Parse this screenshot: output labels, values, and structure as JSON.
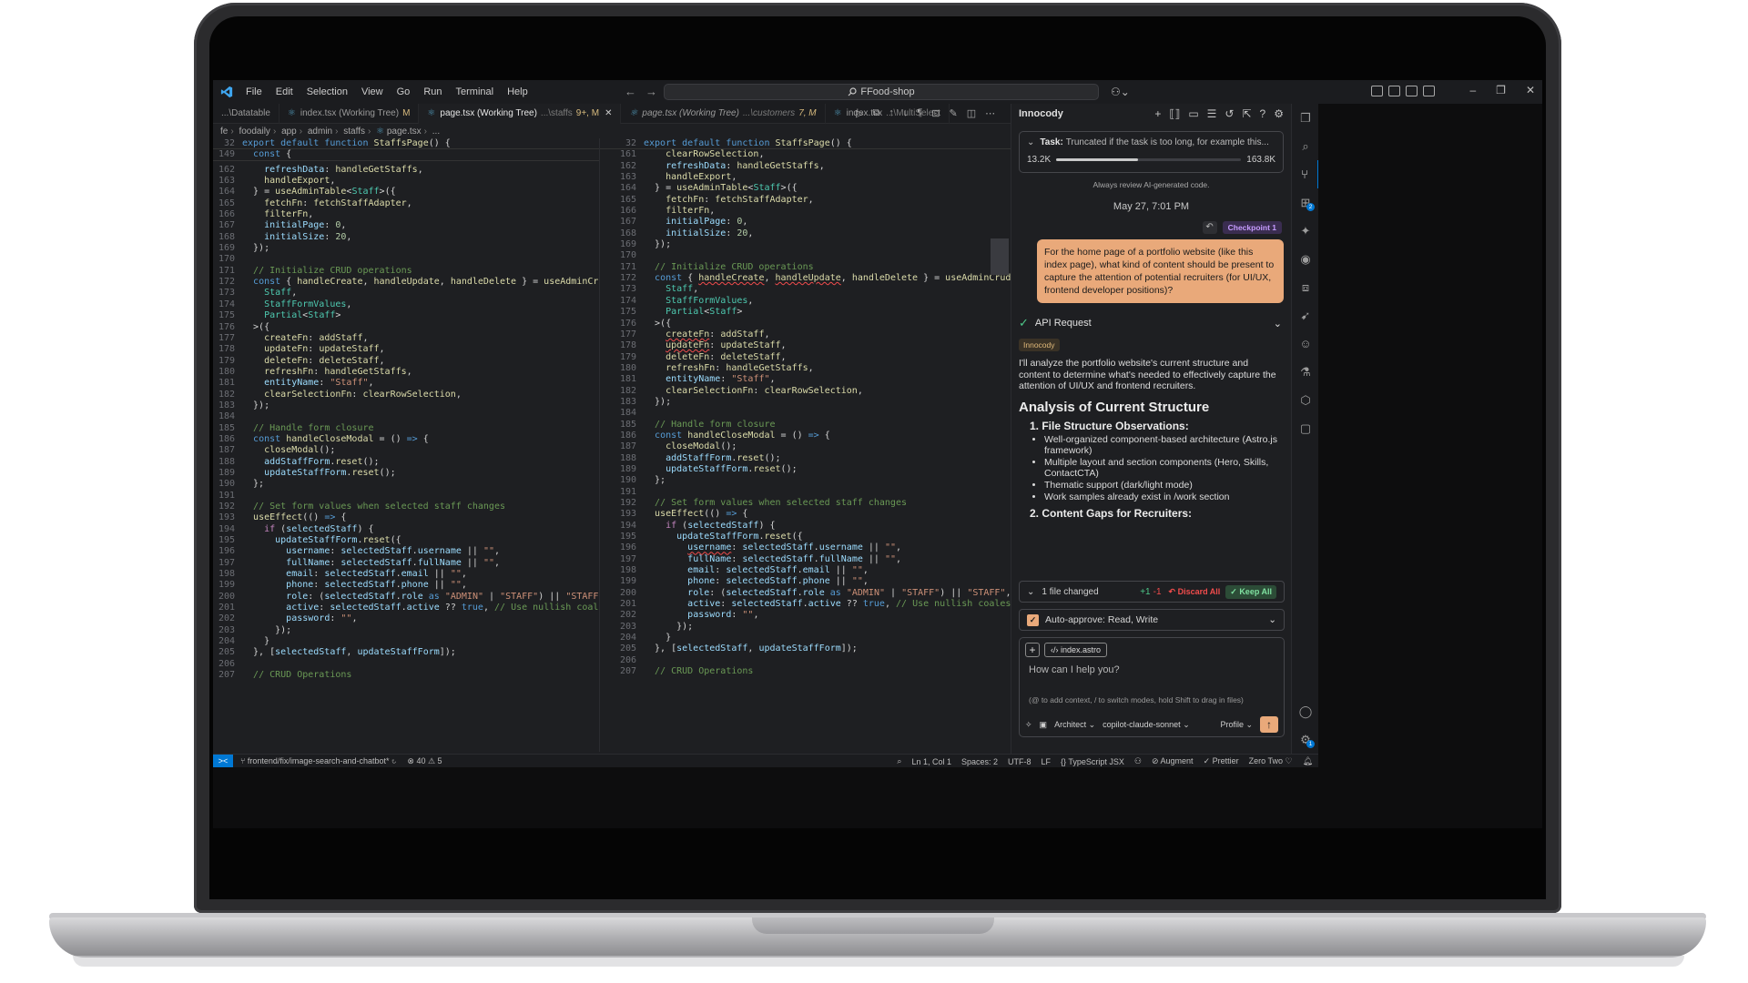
{
  "menu": [
    "File",
    "Edit",
    "Selection",
    "View",
    "Go",
    "Run",
    "Terminal",
    "Help"
  ],
  "search": {
    "label": "FFood-shop"
  },
  "tabs": [
    {
      "name": "index.tsx",
      "detail": "...\\Datatable",
      "mod": "",
      "state": "dim"
    },
    {
      "name": "index.tsx (Working Tree)",
      "detail": "",
      "mod": "M",
      "state": "normal"
    },
    {
      "name": "page.tsx (Working Tree)",
      "detail": "...\\staffs",
      "mod": "9+, M",
      "state": "active"
    },
    {
      "name": "page.tsx (Working Tree)",
      "detail": "...\\customers",
      "mod": "7, M",
      "state": "italic"
    },
    {
      "name": "index.tsx",
      "detail": "...\\MultiSelect",
      "mod": "",
      "state": "dim"
    }
  ],
  "breadcrumb": [
    "fe",
    "foodaily",
    "app",
    "admin",
    "staffs",
    "page.tsx",
    "..."
  ],
  "left_lines": [
    32,
    149,
    162,
    163,
    164,
    165,
    166,
    167,
    168,
    169,
    170,
    171,
    172,
    173,
    174,
    175,
    176,
    177,
    178,
    179,
    180,
    181,
    182,
    183,
    184,
    185,
    186,
    187,
    188,
    189,
    190,
    191,
    192,
    193,
    194,
    195,
    196,
    197,
    198,
    199,
    200,
    201,
    202,
    203,
    204,
    205,
    206,
    207
  ],
  "right_lines": [
    32,
    161,
    162,
    163,
    164,
    165,
    166,
    167,
    168,
    169,
    170,
    171,
    172,
    173,
    174,
    175,
    176,
    177,
    178,
    179,
    180,
    181,
    182,
    183,
    184,
    185,
    186,
    187,
    188,
    189,
    190,
    191,
    192,
    193,
    194,
    195,
    196,
    197,
    198,
    199,
    200,
    201,
    202,
    203,
    204,
    205,
    206,
    207
  ],
  "panel": {
    "title": "Innocody",
    "task_label": "Task:",
    "task_text": "Truncated if the task is too long, for example this...",
    "tokens_used": "13.2K",
    "tokens_max": "163.8K",
    "progress": 0.44,
    "review_note": "Always review AI-generated code.",
    "date": "May 27, 7:01 PM",
    "checkpoint": "Checkpoint 1",
    "user_message": "For the home page of a portfolio website (like this index page), what kind of content should be present to capture the attention of potential recruiters (for UI/UX, frontend developer positions)?",
    "api_request": "API Request",
    "agent_tag": "Innocody",
    "intro": "I'll analyze the portfolio website's current structure and content to determine what's needed to effectively capture the attention of UI/UX and frontend recruiters.",
    "heading": "Analysis of Current Structure",
    "section1": "1. File Structure Observations:",
    "bullets": [
      "Well-organized component-based architecture (Astro.js framework)",
      "Multiple layout and section components (Hero, Skills, ContactCTA)",
      "Thematic support (dark/light mode)",
      "Work samples already exist in /work section"
    ],
    "section2": "2. Content Gaps for Recruiters:",
    "changed": "1 file changed",
    "added": "+1",
    "removed": "-1",
    "discard": "Discard All",
    "keep": "Keep All",
    "auto_approve": "Auto-approve: Read, Write",
    "file_chip": "index.astro",
    "placeholder": "How can I help you?",
    "hint": "(@ to add context, / to switch modes, hold Shift to drag in files)",
    "mode": "Architect",
    "model": "copilot-claude-sonnet",
    "profile": "Profile"
  },
  "status": {
    "branch": "frontend/fix/image-search-and-chatbot*",
    "errors": "40",
    "warnings": "5",
    "position": "Ln 1, Col 1",
    "spaces": "Spaces: 2",
    "encoding": "UTF-8",
    "eol": "LF",
    "language": "TypeScript JSX",
    "augment": "Augment",
    "prettier": "Prettier",
    "theme": "Zero Two"
  },
  "colors": {
    "accent": "#e9a97a",
    "brand_blue": "#0078d4",
    "editor_bg": "#1e1f22"
  }
}
